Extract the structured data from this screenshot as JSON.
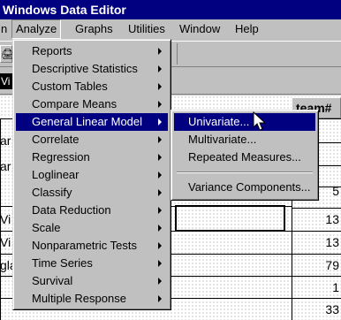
{
  "window": {
    "title": "Windows Data Editor"
  },
  "menubar": {
    "items": [
      {
        "label": "n",
        "key": "partial"
      },
      {
        "label": "Analyze",
        "key": "analyze"
      },
      {
        "label": "Graphs",
        "key": "graphs"
      },
      {
        "label": "Utilities",
        "key": "utilities"
      },
      {
        "label": "Window",
        "key": "window"
      },
      {
        "label": "Help",
        "key": "help"
      }
    ]
  },
  "toolbar": {
    "icon_glyph": "🖨",
    "icon_name": "print-icon"
  },
  "cellbar": {
    "ref": "Vi"
  },
  "grid": {
    "column_header": "team#",
    "rows": [
      {
        "text": "ar",
        "value": ""
      },
      {
        "text": "ar",
        "value": ""
      },
      {
        "text": "",
        "value": ""
      },
      {
        "text": "",
        "value": "5"
      },
      {
        "text": "Vi",
        "value": "13"
      },
      {
        "text": "Vi",
        "value": "13"
      },
      {
        "text": "gla",
        "value": "79"
      },
      {
        "text": "",
        "value": "1"
      },
      {
        "text": "",
        "value": "33"
      }
    ]
  },
  "analyze_menu": {
    "items": [
      {
        "label": "Reports",
        "submenu": true
      },
      {
        "label": "Descriptive Statistics",
        "submenu": true
      },
      {
        "label": "Custom Tables",
        "submenu": true
      },
      {
        "label": "Compare Means",
        "submenu": true
      },
      {
        "label": "General Linear Model",
        "submenu": true,
        "highlighted": true
      },
      {
        "label": "Correlate",
        "submenu": true
      },
      {
        "label": "Regression",
        "submenu": true
      },
      {
        "label": "Loglinear",
        "submenu": true
      },
      {
        "label": "Classify",
        "submenu": true
      },
      {
        "label": "Data Reduction",
        "submenu": true
      },
      {
        "label": "Scale",
        "submenu": true
      },
      {
        "label": "Nonparametric Tests",
        "submenu": true
      },
      {
        "label": "Time Series",
        "submenu": true
      },
      {
        "label": "Survival",
        "submenu": true
      },
      {
        "label": "Multiple Response",
        "submenu": true
      }
    ]
  },
  "glm_submenu": {
    "items": [
      {
        "label": "Univariate...",
        "highlighted": true
      },
      {
        "label": "Multivariate..."
      },
      {
        "label": "Repeated Measures..."
      },
      {
        "label": "Variance Components..."
      }
    ]
  },
  "colors": {
    "titlebar": "#000080",
    "menu_face": "#c0c0c0",
    "highlight": "#000080",
    "highlight_text": "#ffffff"
  }
}
